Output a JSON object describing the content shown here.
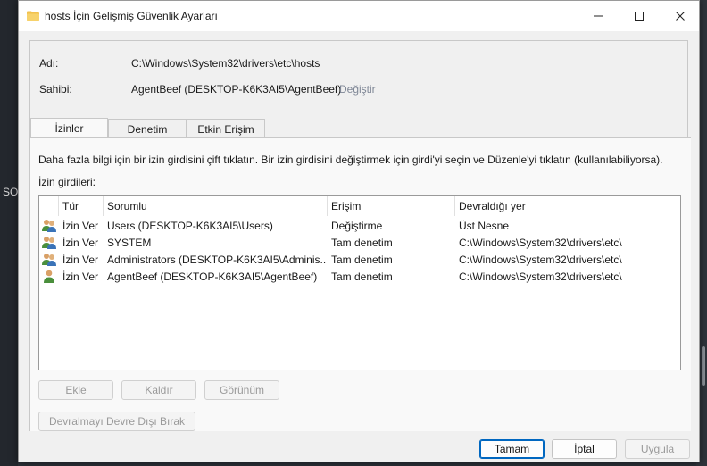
{
  "background": {
    "left_text": "SO"
  },
  "window": {
    "title": "hosts İçin Gelişmiş Güvenlik Ayarları",
    "minimize_symbol": "—",
    "maximize_symbol": "☐",
    "close_symbol": "✕"
  },
  "info": {
    "name_label": "Adı:",
    "name_value": "C:\\Windows\\System32\\drivers\\etc\\hosts",
    "owner_label": "Sahibi:",
    "owner_value": "AgentBeef (DESKTOP-K6K3AI5\\AgentBeef)",
    "change_link": "Değiştir"
  },
  "tabs": [
    {
      "label": "İzinler",
      "active": true
    },
    {
      "label": "Denetim",
      "active": false
    },
    {
      "label": "Etkin Erişim",
      "active": false
    }
  ],
  "permissions": {
    "instruction": "Daha fazla bilgi için bir izin girdisini çift tıklatın. Bir izin girdisini değiştirmek için girdi'yi seçin ve Düzenle'yi tıklatın (kullanılabiliyorsa).",
    "list_label": "İzin girdileri:",
    "columns": [
      "Tür",
      "Sorumlu",
      "Erişim",
      "Devraldığı yer"
    ],
    "rows": [
      {
        "icon": "user-group-icon",
        "type": "İzin Ver",
        "principal": "Users (DESKTOP-K6K3AI5\\Users)",
        "access": "Değiştirme",
        "inherited": "Üst Nesne"
      },
      {
        "icon": "user-group-icon",
        "type": "İzin Ver",
        "principal": "SYSTEM",
        "access": "Tam denetim",
        "inherited": "C:\\Windows\\System32\\drivers\\etc\\"
      },
      {
        "icon": "user-group-icon",
        "type": "İzin Ver",
        "principal": "Administrators (DESKTOP-K6K3AI5\\Adminis...",
        "access": "Tam denetim",
        "inherited": "C:\\Windows\\System32\\drivers\\etc\\"
      },
      {
        "icon": "user-icon",
        "type": "İzin Ver",
        "principal": "AgentBeef (DESKTOP-K6K3AI5\\AgentBeef)",
        "access": "Tam denetim",
        "inherited": "C:\\Windows\\System32\\drivers\\etc\\"
      }
    ],
    "add_button": "Ekle",
    "remove_button": "Kaldır",
    "view_button": "Görünüm",
    "disable_inheritance_button": "Devralmayı Devre Dışı Bırak"
  },
  "footer": {
    "ok_button": "Tamam",
    "cancel_button": "İptal",
    "apply_button": "Uygula"
  },
  "colors": {
    "accent": "#0067c0",
    "link": "#7f8796",
    "folder": "#f2c14e"
  }
}
